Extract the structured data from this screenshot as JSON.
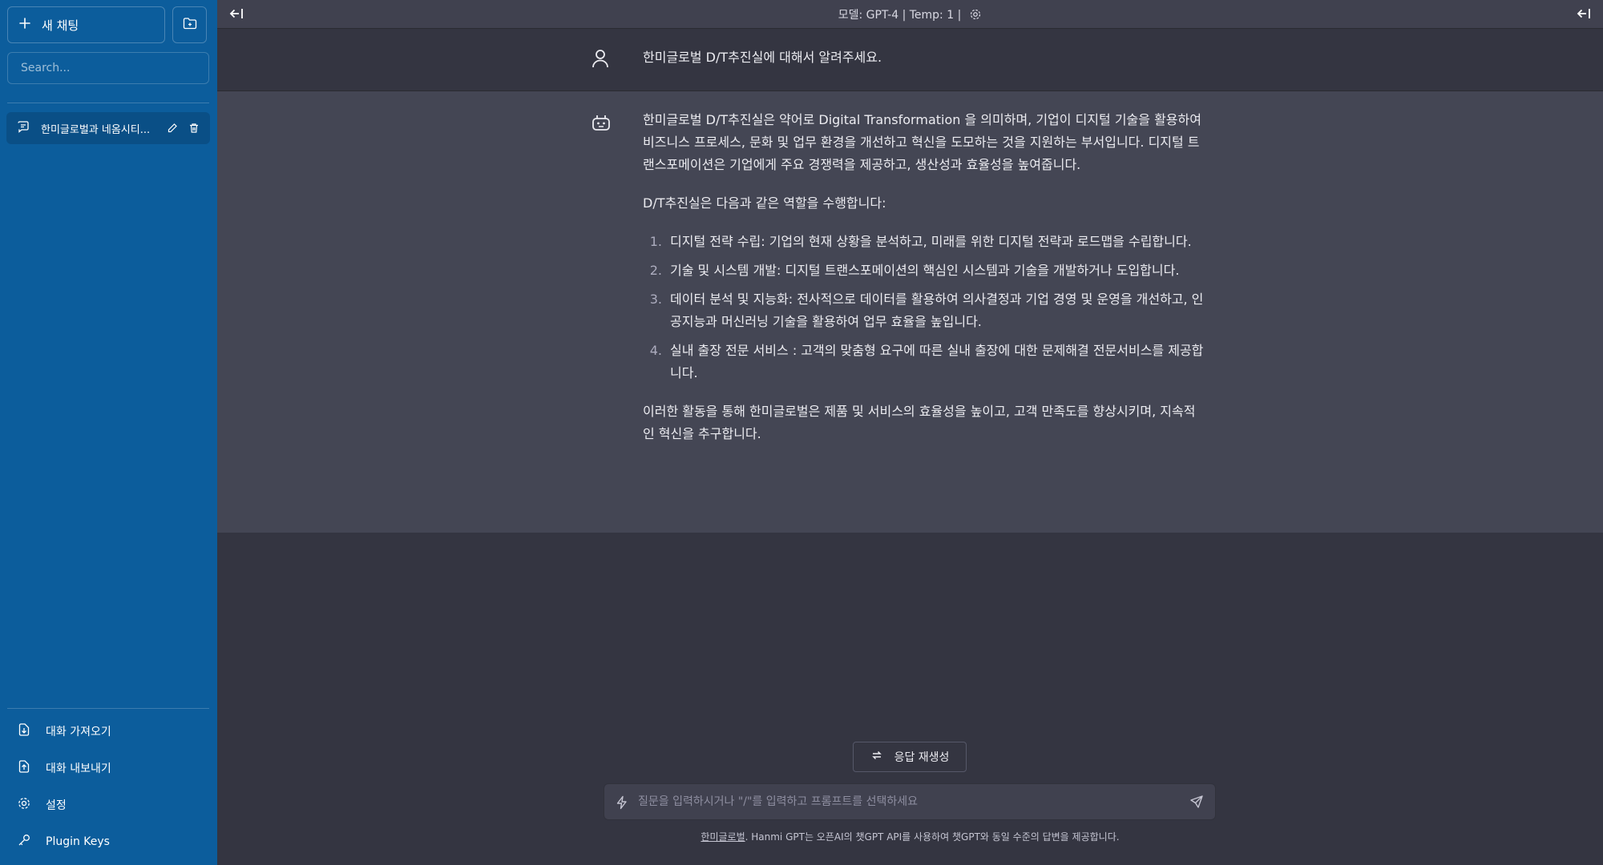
{
  "sidebar": {
    "new_chat_label": "새 채팅",
    "search_placeholder": "Search...",
    "conversations": [
      {
        "title": "한미글로벌과 네옴시티..."
      }
    ],
    "bottom_items": [
      {
        "label": "대화 가져오기",
        "icon": "import-icon"
      },
      {
        "label": "대화 내보내기",
        "icon": "export-icon"
      },
      {
        "label": "설정",
        "icon": "gear-icon"
      },
      {
        "label": "Plugin Keys",
        "icon": "key-icon"
      }
    ],
    "bg_color": "#0c5d9c"
  },
  "topbar": {
    "model_text": "모델: GPT-4 | Temp: 1 |"
  },
  "messages": {
    "user": "한미글로벌 D/T추진실에 대해서 알려주세요.",
    "assistant": {
      "intro": "한미글로벌 D/T추진실은 약어로 Digital Transformation 을 의미하며, 기업이 디지털 기술을 활용하여 비즈니스 프로세스, 문화 및 업무 환경을 개선하고 혁신을 도모하는 것을 지원하는 부서입니다. 디지털 트랜스포메이션은 기업에게 주요 경쟁력을 제공하고, 생산성과 효율성을 높여줍니다.",
      "roles_intro": "D/T추진실은 다음과 같은 역할을 수행합니다:",
      "roles": [
        {
          "num": "1.",
          "text": "디지털 전략 수립: 기업의 현재 상황을 분석하고, 미래를 위한 디지털 전략과 로드맵을 수립합니다."
        },
        {
          "num": "2.",
          "text": "기술 및 시스템 개발: 디지털 트랜스포메이션의 핵심인 시스템과 기술을 개발하거나 도입합니다."
        },
        {
          "num": "3.",
          "text": "데이터 분석 및 지능화: 전사적으로 데이터를 활용하여 의사결정과 기업 경영 및 운영을 개선하고, 인공지능과 머신러닝 기술을 활용하여 업무 효율을 높입니다."
        },
        {
          "num": "4.",
          "text": "실내 출장 전문 서비스 : 고객의 맞춤형 요구에 따른 실내 출장에 대한 문제해결 전문서비스를 제공합니다."
        }
      ],
      "conclusion": "이러한 활동을 통해 한미글로벌은 제품 및 서비스의 효율성을 높이고, 고객 만족도를 향상시키며, 지속적인 혁신을 추구합니다."
    }
  },
  "composer": {
    "regenerate_label": "응답 재생성",
    "input_placeholder": "질문을 입력하시거나 \"/\"를 입력하고 프롬프트를 선택하세요",
    "input_value": ""
  },
  "footer": {
    "link_text": "한미글로벌",
    "text": ". Hanmi GPT는 오픈AI의 챗GPT API를 사용하여 챗GPT와 동일 수준의 답변을 제공합니다."
  }
}
